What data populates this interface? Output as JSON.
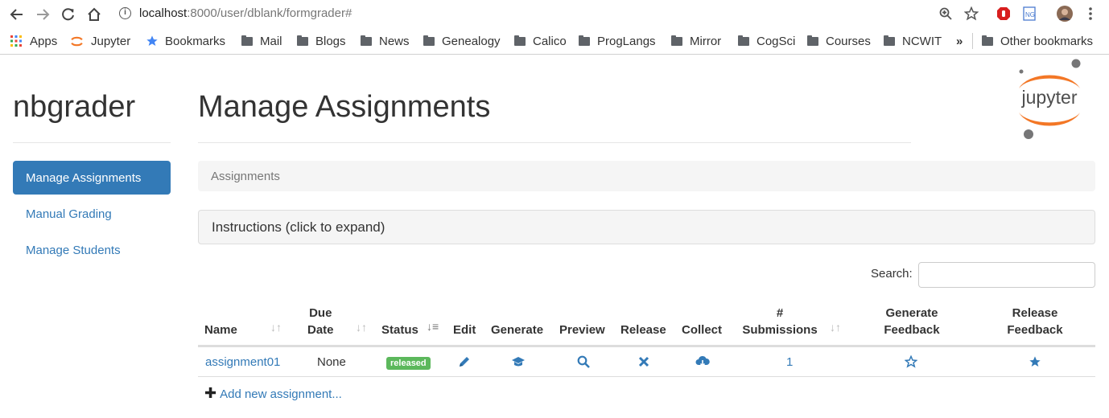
{
  "browser": {
    "url_host": "localhost",
    "url_rest": ":8000/user/dblank/formgrader#",
    "bookmarks": [
      {
        "label": "Apps",
        "icon": "apps-grid-icon"
      },
      {
        "label": "Jupyter",
        "icon": "jupyter-icon"
      },
      {
        "label": "Bookmarks",
        "icon": "star-icon"
      },
      {
        "label": "Mail",
        "icon": "folder-icon"
      },
      {
        "label": "Blogs",
        "icon": "folder-icon"
      },
      {
        "label": "News",
        "icon": "folder-icon"
      },
      {
        "label": "Genealogy",
        "icon": "folder-icon"
      },
      {
        "label": "Calico",
        "icon": "folder-icon"
      },
      {
        "label": "ProgLangs",
        "icon": "folder-icon"
      },
      {
        "label": "Mirror",
        "icon": "folder-icon"
      },
      {
        "label": "CogSci",
        "icon": "folder-icon"
      },
      {
        "label": "Courses",
        "icon": "folder-icon"
      },
      {
        "label": "NCWIT",
        "icon": "folder-icon"
      }
    ],
    "overflow": "»",
    "other_bookmarks": "Other bookmarks"
  },
  "sidebar": {
    "brand": "nbgrader",
    "items": [
      {
        "label": "Manage Assignments",
        "active": true
      },
      {
        "label": "Manual Grading",
        "active": false
      },
      {
        "label": "Manage Students",
        "active": false
      }
    ]
  },
  "logo": {
    "text": "jupyter"
  },
  "main": {
    "title": "Manage Assignments",
    "breadcrumb": "Assignments",
    "instructions": "Instructions (click to expand)",
    "search_label": "Search:",
    "search_value": "",
    "columns": {
      "name": "Name",
      "due_date_1": "Due",
      "due_date_2": "Date",
      "status": "Status",
      "edit": "Edit",
      "generate": "Generate",
      "preview": "Preview",
      "release": "Release",
      "collect": "Collect",
      "submissions_1": "#",
      "submissions_2": "Submissions",
      "gen_feedback_1": "Generate",
      "gen_feedback_2": "Feedback",
      "rel_feedback_1": "Release",
      "rel_feedback_2": "Feedback"
    },
    "rows": [
      {
        "name": "assignment01",
        "due_date": "None",
        "status": "released",
        "submissions": "1"
      }
    ],
    "add_new": "Add new assignment..."
  },
  "colors": {
    "primary": "#337ab7",
    "success": "#5cb85c",
    "jupyter_orange": "#f37726"
  }
}
